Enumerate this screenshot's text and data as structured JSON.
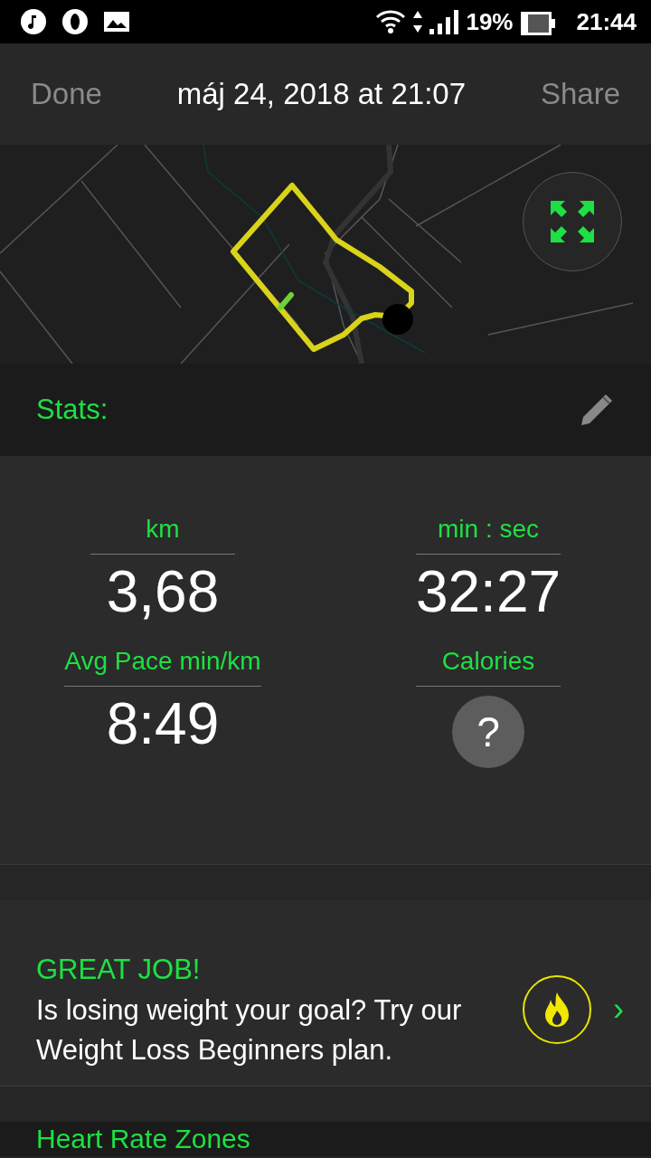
{
  "status_bar": {
    "battery": "19%",
    "time": "21:44"
  },
  "header": {
    "left_button": "Done",
    "title": "máj 24, 2018 at 21:07",
    "right_button": "Share"
  },
  "stats": {
    "title": "Stats:",
    "items": [
      {
        "label": "km",
        "value": "3,68",
        "kind": "value"
      },
      {
        "label": "min : sec",
        "value": "32:27",
        "kind": "value"
      },
      {
        "label": "Avg Pace min/km",
        "value": "8:49",
        "kind": "value"
      },
      {
        "label": "Calories",
        "value": "?",
        "kind": "unknown"
      }
    ]
  },
  "promo": {
    "heading": "GREAT JOB!",
    "text": "Is losing weight your goal? Try our Weight Loss Beginners plan.",
    "chevron": "›"
  },
  "heart_rate": {
    "title": "Heart Rate Zones"
  }
}
